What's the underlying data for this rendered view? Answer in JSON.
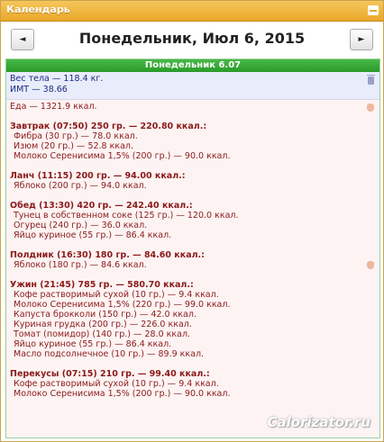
{
  "window": {
    "title": "Календарь"
  },
  "nav": {
    "prev_label": "◄",
    "next_label": "►",
    "date": "Понедельник, Июл 6, 2015"
  },
  "day": {
    "header": "Понедельник 6.07",
    "weight_line": "Вес тела — 118.4 кг.",
    "bmi_line": "ИМТ — 38.66",
    "total_line": "Еда — 1321.9 ккал."
  },
  "meals": [
    {
      "title": "Завтрак (07:50) 250 гр. — 220.80 ккал.:",
      "items": [
        "Фибра (30 гр.) — 78.0 ккал.",
        "Изюм (20 гр.) — 52.8 ккал.",
        "Молоко Серенисима 1,5% (200 гр.) — 90.0 ккал."
      ]
    },
    {
      "title": "Ланч (11:15) 200 гр. — 94.00 ккал.:",
      "items": [
        "Яблоко (200 гр.) — 94.0 ккал."
      ]
    },
    {
      "title": "Обед (13:30) 420 гр. — 242.40 ккал.:",
      "items": [
        "Тунец в собственном соке (125 гр.) — 120.0 ккал.",
        "Огурец (240 гр.) — 36.0 ккал.",
        "Яйцо куриное (55 гр.) — 86.4 ккал."
      ]
    },
    {
      "title": "Полдник (16:30) 180 гр. — 84.60 ккал.:",
      "items": [
        "Яблоко (180 гр.) — 84.6 ккал."
      ]
    },
    {
      "title": "Ужин (21:45) 785 гр. — 580.70 ккал.:",
      "items": [
        "Кофе растворимый сухой (10 гр.) — 9.4 ккал.",
        "Молоко Серенисима 1,5% (220 гр.) — 99.0 ккал.",
        "Капуста брокколи (150 гр.) — 42.0 ккал.",
        "Куриная грудка (200 гр.) — 226.0 ккал.",
        "Томат (помидор) (140 гр.) — 28.0 ккал.",
        "Яйцо куриное (55 гр.) — 86.4 ккал.",
        "Масло подсолнечное (10 гр.) — 89.9 ккал."
      ]
    },
    {
      "title": "Перекусы (07:15) 210 гр. — 99.40 ккал.:",
      "items": [
        "Кофе растворимый сухой (10 гр.) — 9.4 ккал.",
        "Молоко Серенисима 1,5% (200 гр.) — 90.0 ккал."
      ]
    }
  ],
  "watermark": "Calorizator.ru",
  "colors": {
    "titlebar": "#e9a82a",
    "day_header": "#2a9a2a",
    "food_text": "#8a1a1a",
    "weight_text": "#1a2a80"
  }
}
